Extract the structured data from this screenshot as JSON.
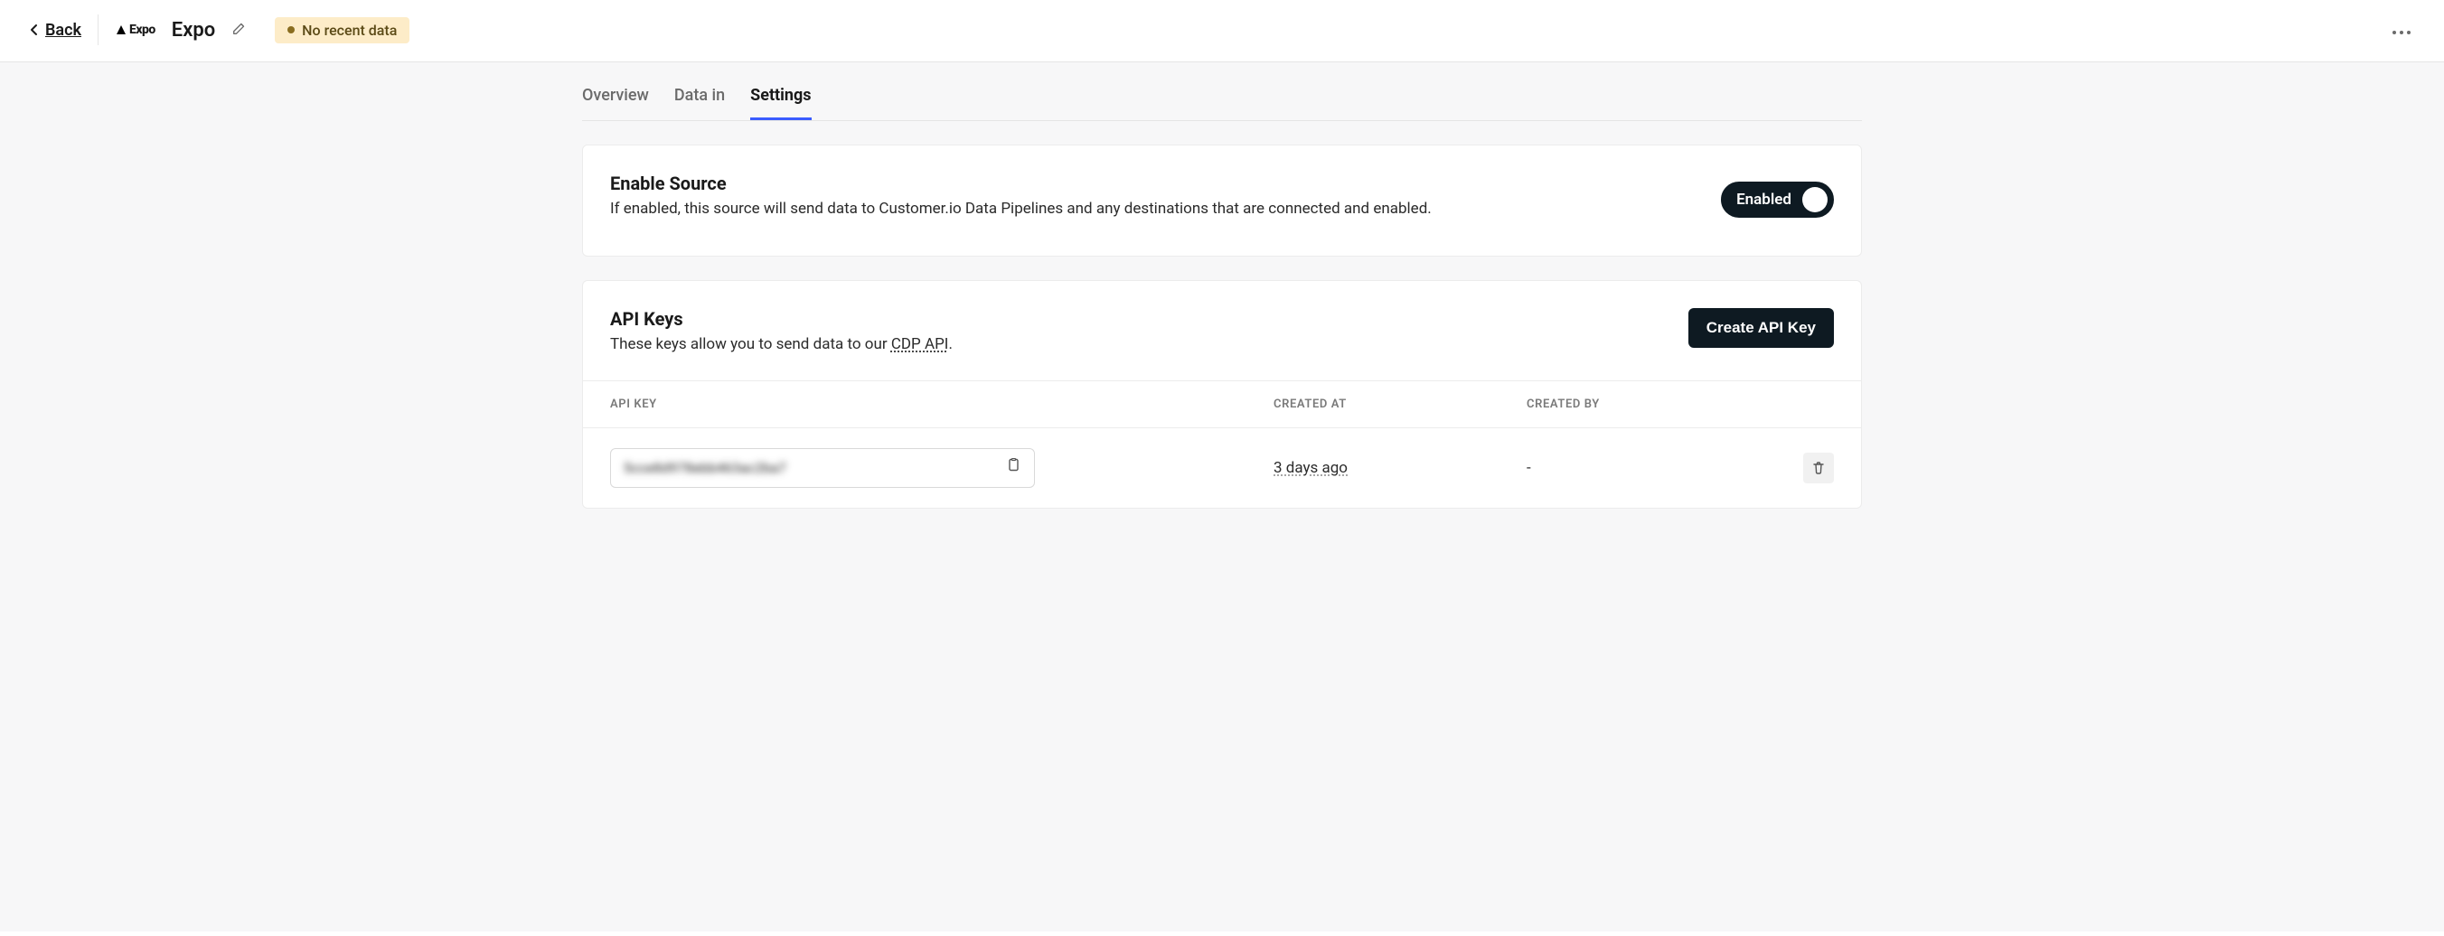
{
  "header": {
    "back_label": "Back",
    "logo_text": "Expo",
    "title": "Expo",
    "status_label": "No recent data"
  },
  "tabs": [
    {
      "label": "Overview",
      "active": false
    },
    {
      "label": "Data in",
      "active": false
    },
    {
      "label": "Settings",
      "active": true
    }
  ],
  "enable_source": {
    "title": "Enable Source",
    "description": "If enabled, this source will send data to Customer.io Data Pipelines and any destinations that are connected and enabled.",
    "toggle_label": "Enabled"
  },
  "api_keys": {
    "title": "API Keys",
    "description_pre": "These keys allow you to send data to our ",
    "description_link": "CDP API",
    "description_post": ".",
    "create_button": "Create API Key",
    "columns": {
      "key": "API KEY",
      "created_at": "CREATED AT",
      "created_by": "CREATED BY"
    },
    "rows": [
      {
        "key_masked": "5cce8d978ebb463ac2ba7",
        "created_at": "3 days ago",
        "created_by": "-"
      }
    ]
  }
}
